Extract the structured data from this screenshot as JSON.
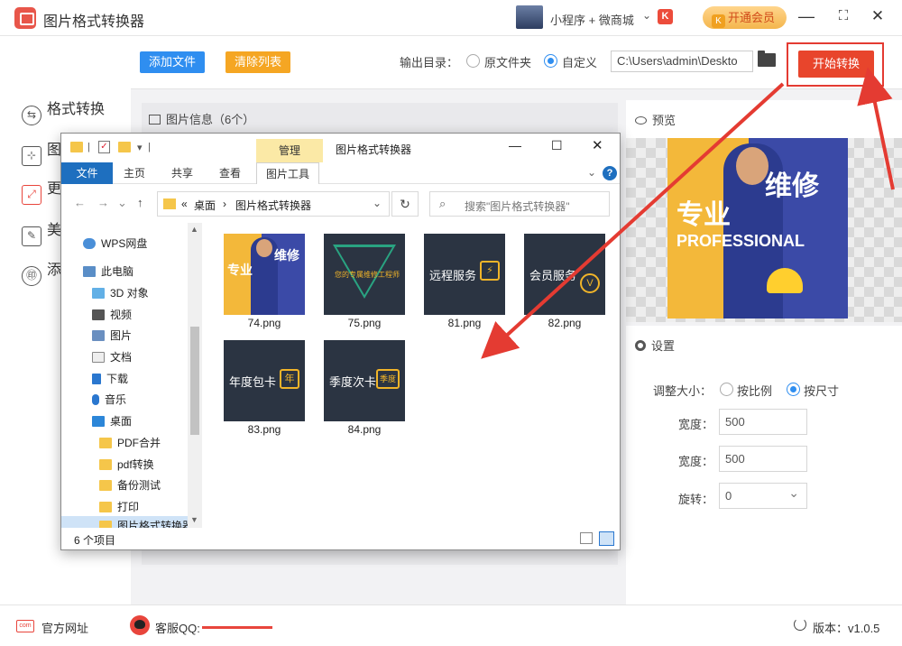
{
  "app": {
    "title": "图片格式转换器",
    "mini_program": "小程序 + 微商城",
    "mini_chevron": "⌄",
    "mini_k": "K",
    "vip_label": "开通会员",
    "vip_k": "K",
    "win_min": "—",
    "win_max": "⛶",
    "win_close": "✕"
  },
  "sidebar": {
    "items": [
      {
        "label": "格式转换",
        "icon": "swap-icon",
        "glyph": "⇆"
      },
      {
        "label": "图",
        "icon": "crop-icon",
        "glyph": "⊹"
      },
      {
        "label": "更",
        "icon": "resize-icon",
        "glyph": "⤢"
      },
      {
        "label": "美",
        "icon": "beautify-icon",
        "glyph": "✎"
      },
      {
        "label": "添",
        "icon": "watermark-icon",
        "glyph": "㊞"
      }
    ]
  },
  "toolbar": {
    "add_file": "添加文件",
    "clear_list": "清除列表",
    "output_dir_label": "输出目录：",
    "radio_original": "原文件夹",
    "radio_custom": "自定义",
    "output_path": "C:\\Users\\admin\\Deskto",
    "start_label": "开始转换"
  },
  "info_panel": {
    "title": "图片信息（6个）"
  },
  "preview": {
    "title": "预览",
    "poster_text_1": "专业",
    "poster_text_2": "维修",
    "poster_text_3": "PROFESSIONAL"
  },
  "settings": {
    "title": "设置",
    "resize_label": "调整大小：",
    "by_ratio": "按比例",
    "by_size": "按尺寸",
    "width_label": "宽度：",
    "width_value": "500",
    "height_label": "宽度：",
    "height_value": "500",
    "rotate_label": "旋转：",
    "rotate_value": "0"
  },
  "footer": {
    "site_icon_text": "com",
    "site_label": "官方网址",
    "qq_label": "客服QQ:",
    "version": "版本：v1.0.5"
  },
  "explorer": {
    "manage_tab": "管理",
    "window_title": "图片格式转换器",
    "min": "—",
    "max": "☐",
    "close": "✕",
    "qa_sep": "▾",
    "ribbon": {
      "file": "文件",
      "home": "主页",
      "share": "共享",
      "view": "查看",
      "picture_tools": "图片工具",
      "expand": "⌄",
      "help": "?"
    },
    "address": {
      "back": "←",
      "forward": "→",
      "dropdown": "⌄",
      "up": "↑",
      "breadcrumb_prefix": "«",
      "crumb_1": "桌面",
      "sep": "›",
      "crumb_2": "图片格式转换器",
      "addr_dropdown": "⌄",
      "refresh": "↻",
      "search_placeholder": "搜索\"图片格式转换器\"",
      "search_icon": "⌕"
    },
    "nav": [
      {
        "label": "WPS网盘",
        "icon": "cloud"
      },
      {
        "label": "此电脑",
        "icon": "pc"
      },
      {
        "label": "3D 对象",
        "icon": "obj"
      },
      {
        "label": "视频",
        "icon": "vid"
      },
      {
        "label": "图片",
        "icon": "pic"
      },
      {
        "label": "文档",
        "icon": "doc"
      },
      {
        "label": "下载",
        "icon": "down"
      },
      {
        "label": "音乐",
        "icon": "music"
      },
      {
        "label": "桌面",
        "icon": "desk"
      },
      {
        "label": "PDF合并",
        "icon": "fold"
      },
      {
        "label": "pdf转换",
        "icon": "fold"
      },
      {
        "label": "备份测试",
        "icon": "fold"
      },
      {
        "label": "打印",
        "icon": "fold"
      },
      {
        "label": "图片格式转换器",
        "icon": "fold"
      }
    ],
    "nav_scroll_up": "▲",
    "nav_scroll_down": "▼",
    "files": [
      {
        "name": "74.png",
        "thumb_text": "专业",
        "thumb_text2": "维修"
      },
      {
        "name": "75.png",
        "thumb_text": "您的专属维修工程师"
      },
      {
        "name": "81.png",
        "thumb_text": "远程服务",
        "badge": "⚡"
      },
      {
        "name": "82.png",
        "thumb_text": "会员服务",
        "badge": "V"
      },
      {
        "name": "83.png",
        "thumb_text": "年度包卡",
        "badge": "年"
      },
      {
        "name": "84.png",
        "thumb_text": "季度次卡",
        "badge": "季度"
      }
    ],
    "status": "6 个项目"
  },
  "colors": {
    "accent_blue": "#2f8ef0",
    "start_red": "#e8452c",
    "annotation_red": "#e43b32",
    "clear_orange": "#f5a623"
  }
}
